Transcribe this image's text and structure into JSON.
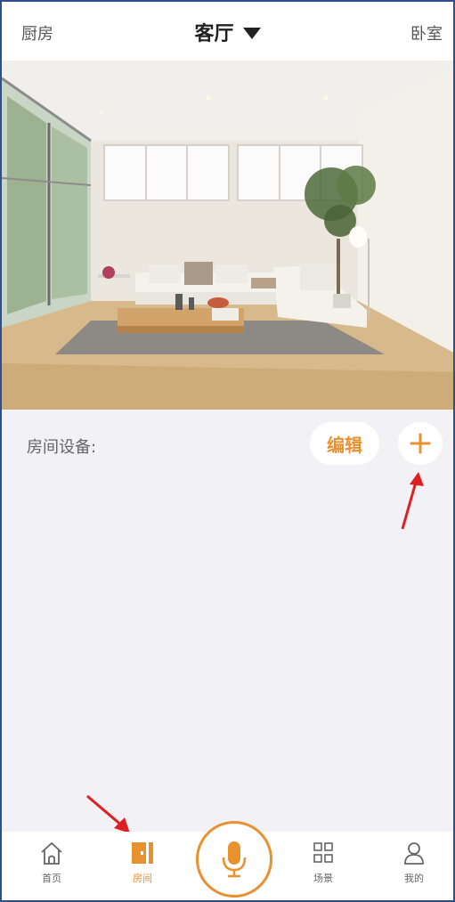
{
  "header": {
    "left_room": "厨房",
    "current_room": "客厅",
    "right_room": "卧室"
  },
  "room_photo": {
    "description_icon": "living-room-photo"
  },
  "devices": {
    "label": "房间设备:",
    "edit_label": "编辑",
    "add_icon": "plus-icon"
  },
  "tabbar": {
    "items": [
      {
        "label": "首页",
        "icon": "home-icon"
      },
      {
        "label": "房间",
        "icon": "door-icon"
      },
      {
        "label": "",
        "icon": "microphone-icon"
      },
      {
        "label": "场景",
        "icon": "grid-icon"
      },
      {
        "label": "我的",
        "icon": "user-icon"
      }
    ]
  },
  "colors": {
    "accent": "#e8912f",
    "annotation": "#e02020",
    "background": "#f1f1f6"
  }
}
